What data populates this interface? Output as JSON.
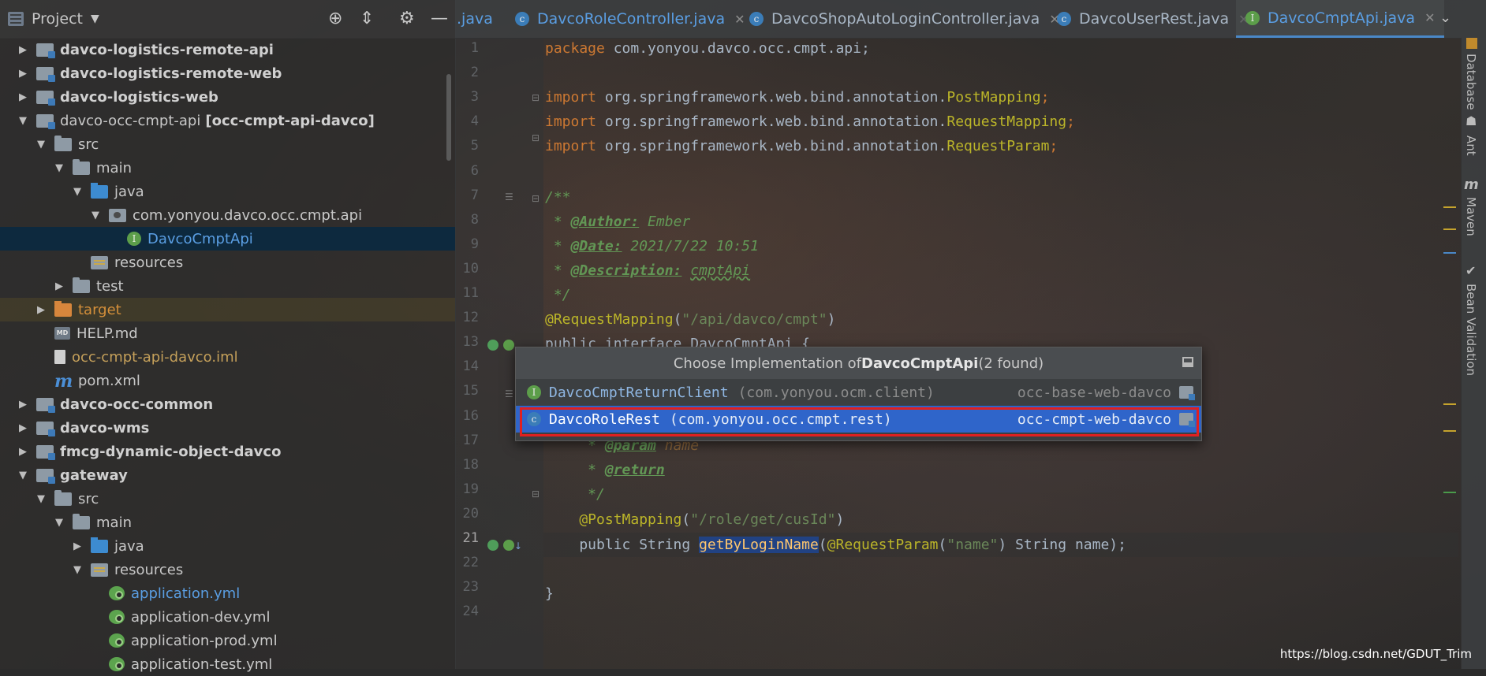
{
  "project_panel": {
    "title": "Project",
    "tree": [
      {
        "label": "davco-logistics-remote-api",
        "icon": "module-folder-icon",
        "style": "bold",
        "arrow": "▶",
        "indent": 0
      },
      {
        "label": "davco-logistics-remote-web",
        "icon": "module-folder-icon",
        "style": "bold",
        "arrow": "▶",
        "indent": 0
      },
      {
        "label": "davco-logistics-web",
        "icon": "module-folder-icon",
        "style": "bold",
        "arrow": "▶",
        "indent": 0
      },
      {
        "label": "davco-occ-cmpt-api",
        "suffix": "[occ-cmpt-api-davco]",
        "icon": "module-folder-icon",
        "style": "normal",
        "arrow": "▼",
        "indent": 0
      },
      {
        "label": "src",
        "icon": "folder-icon",
        "style": "normal",
        "arrow": "▼",
        "indent": 1
      },
      {
        "label": "main",
        "icon": "folder-icon",
        "style": "normal",
        "arrow": "▼",
        "indent": 2
      },
      {
        "label": "java",
        "icon": "source-folder-icon",
        "style": "normal",
        "arrow": "▼",
        "indent": 3
      },
      {
        "label": "com.yonyou.davco.occ.cmpt.api",
        "icon": "package-icon",
        "style": "normal",
        "arrow": "▼",
        "indent": 4
      },
      {
        "label": "DavcoCmptApi",
        "icon": "interface-icon",
        "style": "blue",
        "arrow": "",
        "indent": 5,
        "selected": true
      },
      {
        "label": "resources",
        "icon": "resources-folder-icon",
        "style": "normal",
        "arrow": "",
        "indent": 3
      },
      {
        "label": "test",
        "icon": "folder-icon",
        "style": "normal",
        "arrow": "▶",
        "indent": 2
      },
      {
        "label": "target",
        "icon": "target-folder-icon",
        "style": "orange",
        "arrow": "▶",
        "indent": 1
      },
      {
        "label": "HELP.md",
        "icon": "markdown-file-icon",
        "style": "normal",
        "arrow": "",
        "indent": 1
      },
      {
        "label": "occ-cmpt-api-davco.iml",
        "icon": "iml-file-icon",
        "style": "yellow",
        "arrow": "",
        "indent": 1
      },
      {
        "label": "pom.xml",
        "icon": "maven-icon",
        "style": "normal",
        "arrow": "",
        "indent": 1
      },
      {
        "label": "davco-occ-common",
        "icon": "module-folder-icon",
        "style": "bold",
        "arrow": "▶",
        "indent": 0
      },
      {
        "label": "davco-wms",
        "icon": "module-folder-icon",
        "style": "bold",
        "arrow": "▶",
        "indent": 0
      },
      {
        "label": "fmcg-dynamic-object-davco",
        "icon": "module-folder-icon",
        "style": "bold",
        "arrow": "▶",
        "indent": 0
      },
      {
        "label": "gateway",
        "icon": "module-folder-icon",
        "style": "bold",
        "arrow": "▼",
        "indent": 0
      },
      {
        "label": "src",
        "icon": "folder-icon",
        "style": "normal",
        "arrow": "▼",
        "indent": 1
      },
      {
        "label": "main",
        "icon": "folder-icon",
        "style": "normal",
        "arrow": "▼",
        "indent": 2
      },
      {
        "label": "java",
        "icon": "source-folder-icon",
        "style": "normal",
        "arrow": "▶",
        "indent": 3
      },
      {
        "label": "resources",
        "icon": "resources-folder-icon",
        "style": "normal",
        "arrow": "▼",
        "indent": 3
      },
      {
        "label": "application.yml",
        "icon": "spring-yml-icon",
        "style": "blue",
        "arrow": "",
        "indent": 4
      },
      {
        "label": "application-dev.yml",
        "icon": "spring-yml-icon",
        "style": "normal",
        "arrow": "",
        "indent": 4
      },
      {
        "label": "application-prod.yml",
        "icon": "spring-yml-icon",
        "style": "normal",
        "arrow": "",
        "indent": 4
      },
      {
        "label": "application-test.yml",
        "icon": "spring-yml-icon",
        "style": "normal",
        "arrow": "",
        "indent": 4
      }
    ]
  },
  "tabs": [
    {
      "label": ".java",
      "icon": "",
      "color": "blue",
      "active": false
    },
    {
      "label": "DavcoRoleController.java",
      "icon": "C",
      "color": "blue",
      "active": false
    },
    {
      "label": "DavcoShopAutoLoginController.java",
      "icon": "C",
      "color": "normal",
      "active": false
    },
    {
      "label": "DavcoUserRest.java",
      "icon": "C",
      "color": "normal",
      "active": false
    },
    {
      "label": "DavcoCmptApi.java",
      "icon": "I",
      "color": "blue",
      "active": true
    }
  ],
  "editor": {
    "line_numbers": [
      "1",
      "2",
      "3",
      "4",
      "5",
      "6",
      "7",
      "8",
      "9",
      "10",
      "11",
      "12",
      "13",
      "14",
      "15",
      "16",
      "17",
      "18",
      "19",
      "20",
      "21",
      "22",
      "23",
      "24"
    ],
    "current_line": "21",
    "code": {
      "l1_kw": "package",
      "l1_rest": " com.yonyou.davco.occ.cmpt.api;",
      "l3_kw": "import",
      "l3_pkg": " org.springframework.web.bind.annotation.",
      "l3_cls": "PostMapping",
      "l3_end": ";",
      "l4_kw": "import",
      "l4_pkg": " org.springframework.web.bind.annotation.",
      "l4_cls": "RequestMapping",
      "l4_end": ";",
      "l5_kw": "import",
      "l5_pkg": " org.springframework.web.bind.annotation.",
      "l5_cls": "RequestParam",
      "l5_end": ";",
      "l7": "/**",
      "l8_pre": " * ",
      "l8_tag": "@Author:",
      "l8_val": " Ember",
      "l9_pre": " * ",
      "l9_tag": "@Date:",
      "l9_val": " 2021/7/22 10:51",
      "l10_pre": " * ",
      "l10_tag": "@Description:",
      "l10_val": "cmptApi",
      "l11": " */",
      "l12_ann": "@RequestMapping",
      "l12_open": "(",
      "l12_str": "\"/api/davco/cmpt\"",
      "l12_close": ")",
      "l13": "public interface DavcoCmptApi {",
      "l17_pre": "     * ",
      "l17_tag": "@param",
      "l17_val": " name",
      "l18_pre": "     * ",
      "l18_tag": "@return",
      "l19": "     */",
      "l20_ann": "    @PostMapping",
      "l20_open": "(",
      "l20_str": "\"/role/get/cusId\"",
      "l20_close": ")",
      "l21_a": "    public String ",
      "l21_m": "getByLoginName",
      "l21_b": "(",
      "l21_ann": "@RequestParam",
      "l21_c": "(",
      "l21_str": "\"name\"",
      "l21_d": ") String name);",
      "l23": "}"
    }
  },
  "popup": {
    "title_prefix": "Choose Implementation of ",
    "title_name": "DavcoCmptApi",
    "title_suffix": " (2 found)",
    "items": [
      {
        "name": "DavcoCmptReturnClient",
        "package": "(com.yonyou.ocm.client)",
        "module": "occ-base-web-davco",
        "kind": "I",
        "selected": false
      },
      {
        "name": "DavcoRoleRest",
        "package": "(com.yonyou.occ.cmpt.rest)",
        "module": "occ-cmpt-web-davco",
        "kind": "C",
        "selected": true
      }
    ]
  },
  "right_tools": [
    "Database",
    "Ant",
    "Maven",
    "Bean Validation"
  ],
  "watermark": "https://blog.csdn.net/GDUT_Trim"
}
